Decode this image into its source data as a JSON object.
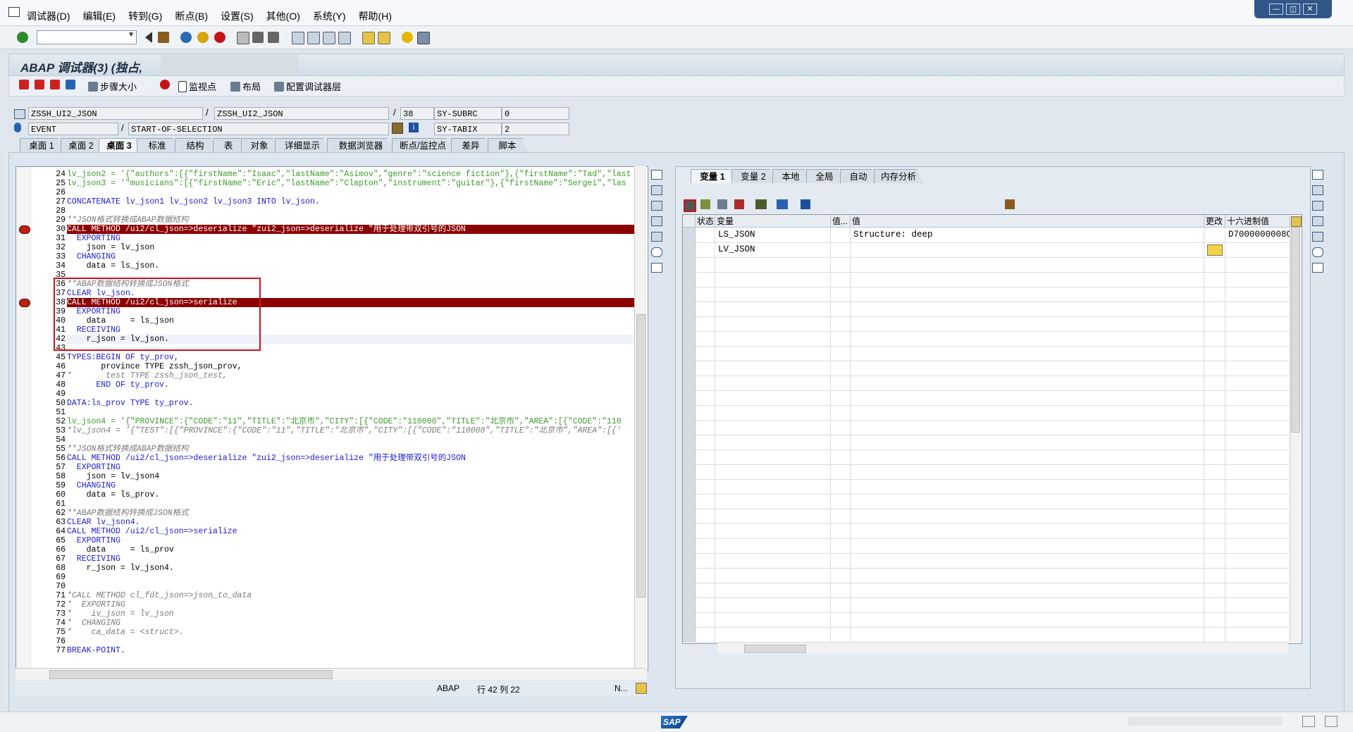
{
  "menu": [
    "调试器(D)",
    "编辑(E)",
    "转到(G)",
    "断点(B)",
    "设置(S)",
    "其他(O)",
    "系统(Y)",
    "帮助(H)"
  ],
  "window_buttons": [
    "—",
    "◫",
    "✕"
  ],
  "title": "ABAP 调试器(3) (独占,",
  "app_toolbar": {
    "step_size": "步骤大小",
    "watchpoint": "监视点",
    "layout": "布局",
    "configure": "配置调试器层"
  },
  "fields": {
    "program": "ZSSH_UI2_JSON",
    "include": "ZSSH_UI2_JSON",
    "line": "38",
    "sy_subrc_label": "SY-SUBRC",
    "sy_subrc_value": "0",
    "event_type": "EVENT",
    "event_name": "START-OF-SELECTION",
    "sy_tabix_label": "SY-TABIX",
    "sy_tabix_value": "2",
    "sep1": "/",
    "sep2": "/"
  },
  "desktop_tabs": [
    "桌面 1",
    "桌面 2",
    "桌面 3",
    "标准",
    "结构",
    "表",
    "对象",
    "详细显示",
    "数据浏览器",
    "断点/监控点",
    "差异",
    "脚本"
  ],
  "active_desktop_tab": "桌面 3",
  "code_lines": [
    {
      "n": "24",
      "t": "lv_json2 = '{\"authors\":[{\"firstName\":\"Isaac\",\"lastName\":\"Asimov\",\"genre\":\"science fiction\"},{\"firstName\":\"Tad\",\"last",
      "k": "str"
    },
    {
      "n": "25",
      "t": "lv_json3 = '\"musicians\":[{\"firstName\":\"Eric\",\"lastName\":\"Clapton\",\"instrument\":\"guitar\"},{\"firstName\":\"Sergei\",\"las",
      "k": "str"
    },
    {
      "n": "26",
      "t": "",
      "k": ""
    },
    {
      "n": "27",
      "t": "CONCATENATE lv_json1 lv_json2 lv_json3 INTO lv_json.",
      "k": "kw"
    },
    {
      "n": "28",
      "t": "",
      "k": ""
    },
    {
      "n": "29",
      "t": "**JSON格式转换成ABAP数据结构",
      "k": "cm"
    },
    {
      "n": "30",
      "t": "CALL METHOD /ui2/cl_json=>deserialize \"zui2_json=>deserialize \"用于处理带双引号的JSON",
      "k": "bp"
    },
    {
      "n": "31",
      "t": "  EXPORTING",
      "k": "kw"
    },
    {
      "n": "32",
      "t": "    json = lv_json",
      "k": ""
    },
    {
      "n": "33",
      "t": "  CHANGING",
      "k": "kw"
    },
    {
      "n": "34",
      "t": "    data = ls_json.",
      "k": ""
    },
    {
      "n": "35",
      "t": "",
      "k": ""
    },
    {
      "n": "36",
      "t": "**ABAP数据结构转换成JSON格式",
      "k": "cm"
    },
    {
      "n": "37",
      "t": "CLEAR lv_json.",
      "k": "kw"
    },
    {
      "n": "38",
      "t": "CALL METHOD /ui2/cl_json=>serialize",
      "k": "bp"
    },
    {
      "n": "39",
      "t": "  EXPORTING",
      "k": "kw"
    },
    {
      "n": "40",
      "t": "    data     = ls_json",
      "k": ""
    },
    {
      "n": "41",
      "t": "  RECEIVING",
      "k": "kw"
    },
    {
      "n": "42",
      "t": "    r_json = lv_json.",
      "k": "cur"
    },
    {
      "n": "43",
      "t": "",
      "k": ""
    },
    {
      "n": "45",
      "t": "TYPES:BEGIN OF ty_prov,",
      "k": "kw"
    },
    {
      "n": "46",
      "t": "       province TYPE zssh_json_prov,",
      "k": ""
    },
    {
      "n": "47",
      "t": "*       test TYPE zssh_json_test,",
      "k": "cm"
    },
    {
      "n": "48",
      "t": "      END OF ty_prov.",
      "k": "kw"
    },
    {
      "n": "49",
      "t": "",
      "k": ""
    },
    {
      "n": "50",
      "t": "DATA:ls_prov TYPE ty_prov.",
      "k": "kw"
    },
    {
      "n": "51",
      "t": "",
      "k": ""
    },
    {
      "n": "52",
      "t": "lv_json4 = '{\"PROVINCE\":{\"CODE\":\"11\",\"TITLE\":\"北京市\",\"CITY\":[{\"CODE\":\"110000\",\"TITLE\":\"北京市\",\"AREA\":[{\"CODE\":\"110",
      "k": "str"
    },
    {
      "n": "53",
      "t": "*lv_json4 = '{\"TEST\":[{\"PROVINCE\":{\"CODE\":\"11\",\"TITLE\":\"北京市\",\"CITY\":[{\"CODE\":\"110000\",\"TITLE\":\"北京市\",\"AREA\":[{'",
      "k": "cm"
    },
    {
      "n": "54",
      "t": "",
      "k": ""
    },
    {
      "n": "55",
      "t": "**JSON格式转换成ABAP数据结构",
      "k": "cm"
    },
    {
      "n": "56",
      "t": "CALL METHOD /ui2/cl_json=>deserialize \"zui2_json=>deserialize \"用于处理带双引号的JSON",
      "k": "kw"
    },
    {
      "n": "57",
      "t": "  EXPORTING",
      "k": "kw"
    },
    {
      "n": "58",
      "t": "    json = lv_json4",
      "k": ""
    },
    {
      "n": "59",
      "t": "  CHANGING",
      "k": "kw"
    },
    {
      "n": "60",
      "t": "    data = ls_prov.",
      "k": ""
    },
    {
      "n": "61",
      "t": "",
      "k": ""
    },
    {
      "n": "62",
      "t": "**ABAP数据结构转换成JSON格式",
      "k": "cm"
    },
    {
      "n": "63",
      "t": "CLEAR lv_json4.",
      "k": "kw"
    },
    {
      "n": "64",
      "t": "CALL METHOD /ui2/cl_json=>serialize",
      "k": "kw"
    },
    {
      "n": "65",
      "t": "  EXPORTING",
      "k": "kw"
    },
    {
      "n": "66",
      "t": "    data     = ls_prov",
      "k": ""
    },
    {
      "n": "67",
      "t": "  RECEIVING",
      "k": "kw"
    },
    {
      "n": "68",
      "t": "    r_json = lv_json4.",
      "k": ""
    },
    {
      "n": "69",
      "t": "",
      "k": ""
    },
    {
      "n": "70",
      "t": "",
      "k": ""
    },
    {
      "n": "71",
      "t": "*CALL METHOD cl_fdt_json=>json_to_data",
      "k": "cm"
    },
    {
      "n": "72",
      "t": "*  EXPORTING",
      "k": "cm"
    },
    {
      "n": "73",
      "t": "*    iv_json = lv_json",
      "k": "cm"
    },
    {
      "n": "74",
      "t": "*  CHANGING",
      "k": "cm"
    },
    {
      "n": "75",
      "t": "*    ca_data = <struct>.",
      "k": "cm"
    },
    {
      "n": "76",
      "t": "",
      "k": ""
    },
    {
      "n": "77",
      "t": "BREAK-POINT.",
      "k": "kw"
    }
  ],
  "editor_status": {
    "lang": "ABAP",
    "pos": "行 42 列 22",
    "mode": "N..."
  },
  "var_tabs": [
    "变量 1",
    "变量 2",
    "本地",
    "全局",
    "自动",
    "内存分析"
  ],
  "active_var_tab": "变量 1",
  "grid_headers": {
    "status": "状态",
    "var": "变量",
    "val_trunc": "值...",
    "value": "值",
    "change": "更改",
    "hex": "十六进制值"
  },
  "grid_rows": [
    {
      "var": "LS_JSON",
      "value": "Structure: deep",
      "hex": "D7000000008C"
    },
    {
      "var": "LV_JSON",
      "value": "",
      "hex": ""
    }
  ],
  "status_bar": {
    "logo": "SAP"
  },
  "colors": {
    "breakpoint": "#8b0000",
    "highlight_box": "#d1101a",
    "keyword": "#1a1ad6",
    "comment": "#7b7b7b",
    "string": "#3b9a2b"
  }
}
